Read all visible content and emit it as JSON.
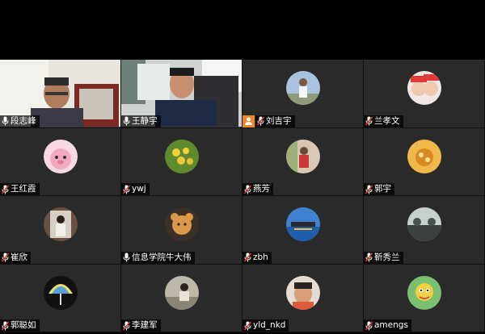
{
  "participants": [
    {
      "name": "段志峰",
      "mic": "on",
      "type": "video"
    },
    {
      "name": "王静宇",
      "mic": "on",
      "type": "video"
    },
    {
      "name": "刘吉宇",
      "mic": "muted",
      "type": "avatar",
      "host": true,
      "avatar_color": "#8aa7c9"
    },
    {
      "name": "兰孝文",
      "mic": "muted",
      "type": "avatar",
      "avatar_color": "#e6b3b3"
    },
    {
      "name": "王红霞",
      "mic": "muted",
      "type": "avatar",
      "avatar_color": "#f2b5c8"
    },
    {
      "name": "ywj",
      "mic": "muted",
      "type": "avatar",
      "avatar_color": "#7fae3a"
    },
    {
      "name": "燕芳",
      "mic": "muted",
      "type": "avatar",
      "avatar_color": "#c9a38a"
    },
    {
      "name": "郭宇",
      "mic": "muted",
      "type": "avatar",
      "avatar_color": "#e8a83a"
    },
    {
      "name": "崔欣",
      "mic": "muted",
      "type": "avatar",
      "avatar_color": "#9a7a64"
    },
    {
      "name": "信息学院牛大伟",
      "mic": "on",
      "type": "avatar",
      "avatar_color": "#b07a3a"
    },
    {
      "name": "zbh",
      "mic": "muted",
      "type": "avatar",
      "avatar_color": "#4a86c8"
    },
    {
      "name": "靳秀兰",
      "mic": "muted",
      "type": "avatar",
      "avatar_color": "#6f8a8a"
    },
    {
      "name": "郭聪如",
      "mic": "muted",
      "type": "avatar",
      "avatar_color": "#5aa0d8"
    },
    {
      "name": "李建军",
      "mic": "muted",
      "type": "avatar",
      "avatar_color": "#8c8c7a"
    },
    {
      "name": "yld_nkd",
      "mic": "muted",
      "type": "avatar",
      "avatar_color": "#c89a7a"
    },
    {
      "name": "amengs",
      "mic": "muted",
      "type": "avatar",
      "avatar_color": "#7ac070"
    }
  ],
  "icons": {
    "mic_on": "microphone-icon",
    "mic_muted": "microphone-muted-icon",
    "host": "host-person-icon"
  },
  "colors": {
    "background": "#000000",
    "tile": "#2a2a2a",
    "muted_slash": "#e0352b",
    "host_badge": "#f0882a"
  }
}
